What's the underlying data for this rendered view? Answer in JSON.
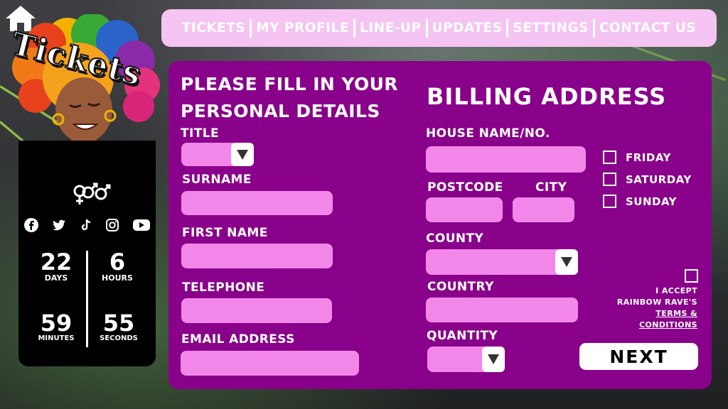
{
  "nav": {
    "items": [
      "TICKETS",
      "MY PROFILE",
      "LINE-UP",
      "UPDATES",
      "SETTINGS",
      "CONTACT US"
    ]
  },
  "logo": {
    "text": "Tickets"
  },
  "icons": {
    "home": "home-icon",
    "music_note": "music-note-icon",
    "gender_symbols": "gender-symbols-icon",
    "social": [
      "facebook-icon",
      "twitter-icon",
      "tiktok-icon",
      "instagram-icon",
      "youtube-icon"
    ]
  },
  "countdown": {
    "days": "22",
    "days_label": "DAYS",
    "hours": "6",
    "hours_label": "HOURS",
    "minutes": "59",
    "minutes_label": "MINUTES",
    "seconds": "55",
    "seconds_label": "SECONDS"
  },
  "personal": {
    "heading": "PLEASE FILL IN YOUR PERSONAL DETAILS",
    "title_label": "TITLE",
    "surname_label": "SURNAME",
    "first_name_label": "FIRST NAME",
    "telephone_label": "TELEPHONE",
    "email_label": "EMAIL ADDRESS"
  },
  "billing": {
    "heading": "BILLING ADDRESS",
    "house_label": "HOUSE NAME/NO.",
    "postcode_label": "POSTCODE",
    "city_label": "CITY",
    "county_label": "COUNTY",
    "country_label": "COUNTRY",
    "quantity_label": "QUANTITY"
  },
  "days_select": {
    "friday": "FRIDAY",
    "saturday": "SATURDAY",
    "sunday": "SUNDAY"
  },
  "terms": {
    "line1": "I ACCEPT",
    "line2": "RAINBOW RAVE'S",
    "link1": "TERMS &",
    "link2": "CONDITIONS"
  },
  "next_label": "NEXT",
  "colors": {
    "card": "#89018a",
    "field": "#f287e9",
    "navbar": "#f5c4f3"
  }
}
